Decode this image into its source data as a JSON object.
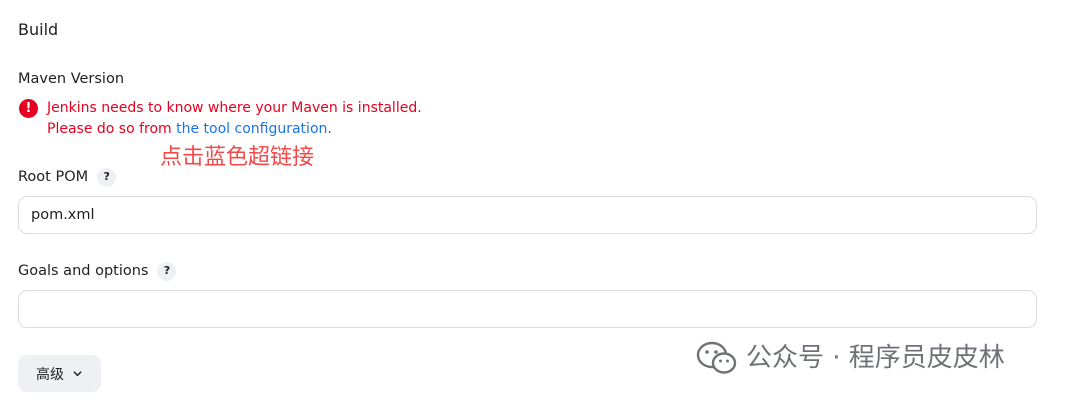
{
  "section": {
    "title": "Build"
  },
  "maven_version": {
    "label": "Maven Version",
    "error_line1": "Jenkins needs to know where your Maven is installed.",
    "error_line2_prefix": "Please do so from ",
    "error_link": "the tool configuration",
    "error_line2_suffix": ".",
    "error_icon_glyph": "!"
  },
  "annotation": {
    "text": "点击蓝色超链接"
  },
  "root_pom": {
    "label": "Root POM",
    "help": "?",
    "value": "pom.xml"
  },
  "goals": {
    "label": "Goals and options",
    "help": "?",
    "value": ""
  },
  "advanced": {
    "label": "高级"
  },
  "watermark": {
    "text": "公众号 · 程序员皮皮林"
  },
  "colors": {
    "error": "#e6001f",
    "link": "#1a73e8",
    "annotation": "#f24a4a"
  },
  "icons": {
    "error": "error-circle-icon",
    "help": "help-icon",
    "chevron": "chevron-down-icon",
    "wechat": "wechat-logo"
  }
}
